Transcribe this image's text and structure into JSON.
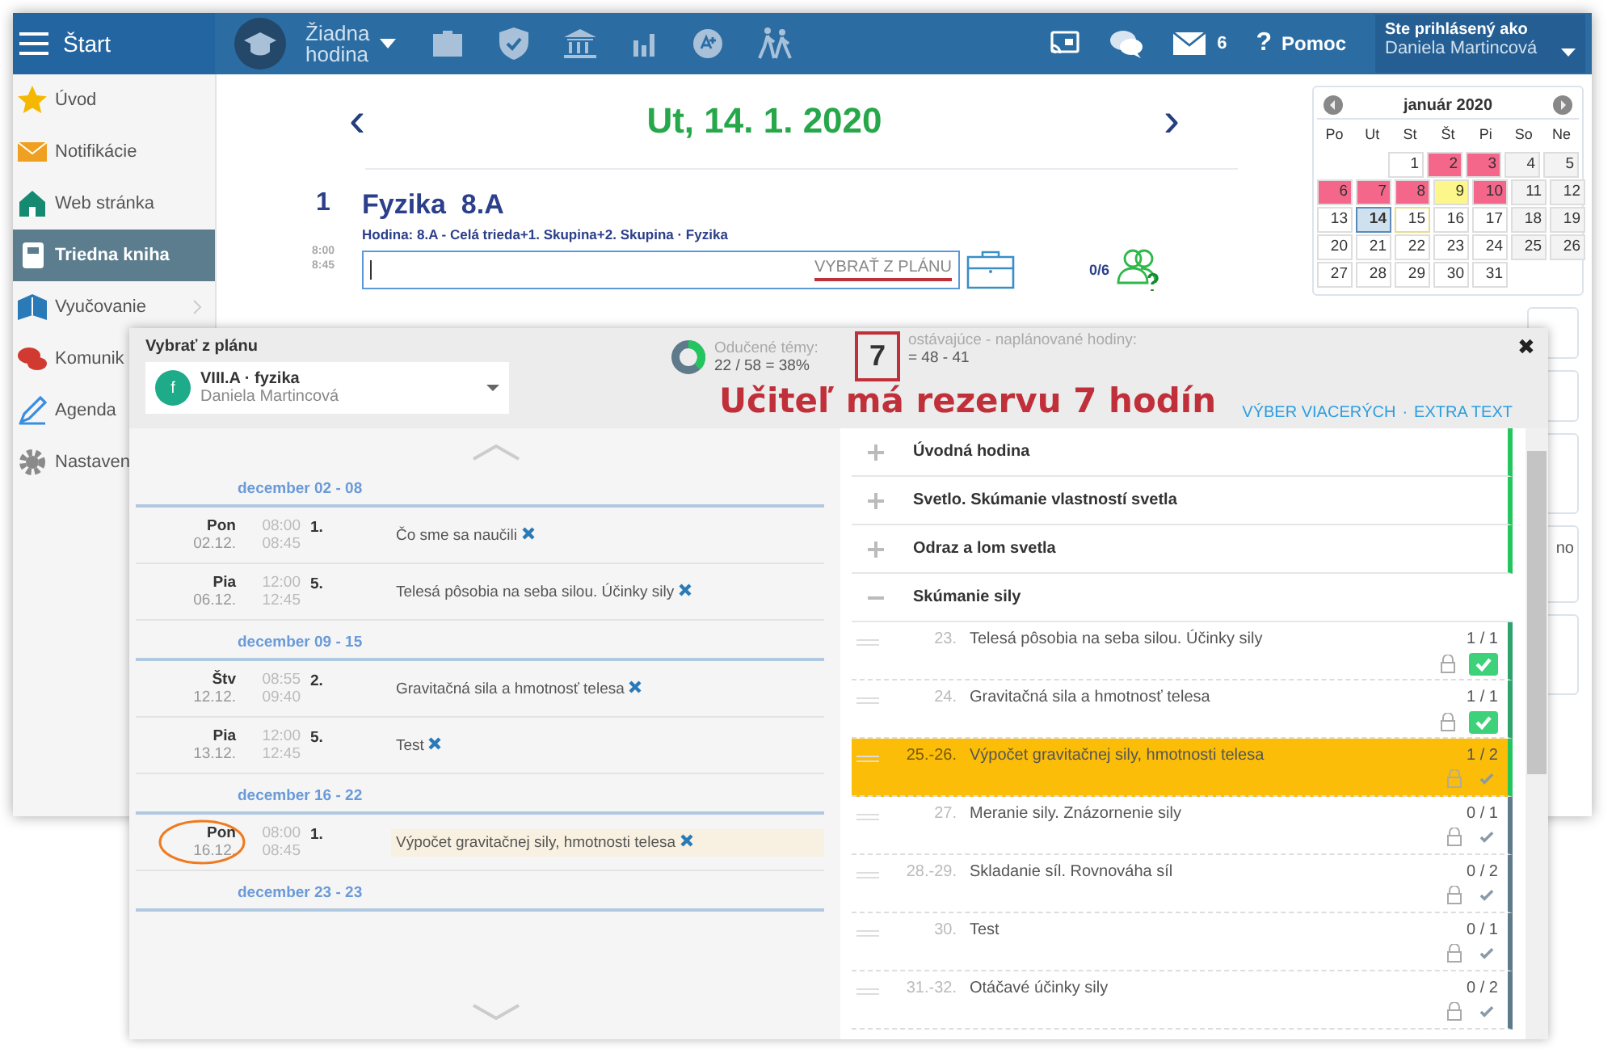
{
  "topbar": {
    "menu_label": "Štart",
    "lesson_select": [
      "Žiadna",
      "hodina"
    ],
    "messages_count": "6",
    "help_mark": "?",
    "help": "Pomoc",
    "user_caption": "Ste prihlásený ako",
    "user_name": "Daniela Martincová"
  },
  "sidebar": {
    "items": [
      {
        "kind": "star",
        "label": "Úvod",
        "selected": false,
        "expandable": false
      },
      {
        "kind": "mail",
        "label": "Notifikácie",
        "selected": false,
        "expandable": false
      },
      {
        "kind": "home",
        "label": "Web stránka",
        "selected": false,
        "expandable": false
      },
      {
        "kind": "book",
        "label": "Triedna kniha",
        "selected": true,
        "expandable": false
      },
      {
        "kind": "open-book",
        "label": "Vyučovanie",
        "selected": false,
        "expandable": true
      },
      {
        "kind": "chat",
        "label": "Komunik",
        "selected": false,
        "expandable": false
      },
      {
        "kind": "pen",
        "label": "Agenda",
        "selected": false,
        "expandable": false
      },
      {
        "kind": "gear",
        "label": "Nastaven",
        "selected": false,
        "expandable": false
      }
    ]
  },
  "day_view": {
    "prev": "‹",
    "date": "Ut, 14. 1. 2020",
    "next": "›",
    "lesson": {
      "number": "1",
      "subject": "Fyzika",
      "class": "8.A",
      "detail": "Hodina:  8.A - Celá trieda+1. Skupina+2. Skupina · Fyzika",
      "start": "8:00",
      "end": "8:45",
      "plan_link": "VYBRAŤ Z PLÁNU",
      "attendance": "0/6"
    }
  },
  "calendar": {
    "title": "január 2020",
    "weekdays": [
      "Po",
      "Ut",
      "St",
      "Št",
      "Pi",
      "So",
      "Ne"
    ],
    "weeks": [
      {
        "starts_midweek": true,
        "days": [
          {
            "day": "1",
            "kind": "weekday",
            "selected": false
          },
          {
            "day": "2",
            "kind": "weekday",
            "color": "#f4668a",
            "selected": false
          },
          {
            "day": "3",
            "kind": "weekday",
            "color": "#f4668a",
            "selected": false
          },
          {
            "day": "4",
            "kind": "weekend",
            "selected": false
          },
          {
            "day": "5",
            "kind": "weekend",
            "selected": false
          }
        ]
      },
      {
        "starts_midweek": false,
        "days": [
          {
            "day": "6",
            "kind": "weekday",
            "color": "#f4668a",
            "selected": false
          },
          {
            "day": "7",
            "kind": "weekday",
            "color": "#f4668a",
            "selected": false
          },
          {
            "day": "8",
            "kind": "weekday",
            "color": "#f4668a",
            "selected": false
          },
          {
            "day": "9",
            "kind": "weekday",
            "color": "#fdf68a",
            "selected": false
          },
          {
            "day": "10",
            "kind": "weekday",
            "color": "#f4668a",
            "selected": false
          },
          {
            "day": "11",
            "kind": "weekend",
            "selected": false
          },
          {
            "day": "12",
            "kind": "weekend",
            "selected": false
          }
        ]
      },
      {
        "starts_midweek": false,
        "days": [
          {
            "day": "13",
            "kind": "weekday",
            "selected": false
          },
          {
            "day": "14",
            "kind": "weekday",
            "selected": true
          },
          {
            "day": "15",
            "kind": "outlined",
            "selected": false
          },
          {
            "day": "16",
            "kind": "weekday",
            "selected": false
          },
          {
            "day": "17",
            "kind": "weekday",
            "selected": false
          },
          {
            "day": "18",
            "kind": "weekend",
            "selected": false
          },
          {
            "day": "19",
            "kind": "weekend",
            "selected": false
          }
        ]
      },
      {
        "starts_midweek": false,
        "days": [
          {
            "day": "20",
            "kind": "weekday",
            "selected": false
          },
          {
            "day": "21",
            "kind": "weekday",
            "selected": false
          },
          {
            "day": "22",
            "kind": "weekday",
            "selected": false
          },
          {
            "day": "23",
            "kind": "weekday",
            "selected": false
          },
          {
            "day": "24",
            "kind": "weekday",
            "selected": false
          },
          {
            "day": "25",
            "kind": "weekend",
            "selected": false
          },
          {
            "day": "26",
            "kind": "weekend",
            "selected": false
          }
        ]
      },
      {
        "starts_midweek": false,
        "days": [
          {
            "day": "27",
            "kind": "weekday",
            "selected": false
          },
          {
            "day": "28",
            "kind": "weekday",
            "selected": false
          },
          {
            "day": "29",
            "kind": "weekday",
            "selected": false
          },
          {
            "day": "30",
            "kind": "weekday",
            "selected": false
          },
          {
            "day": "31",
            "kind": "weekday",
            "selected": false
          }
        ]
      }
    ]
  },
  "side_card_text": "no",
  "plan_dialog": {
    "title": "Vybrať z plánu",
    "plan": {
      "avatar": "f",
      "name": "VIII.A · fyzika",
      "teacher": "Daniela Martincová"
    },
    "progress": {
      "label": "Odučené témy:",
      "value": "22 / 58 = 38%",
      "level": 0.38
    },
    "remaining": {
      "count": "7",
      "label": "ostávajúce - naplánované hodiny:",
      "value": "= 48 - 41"
    },
    "links": [
      "VÝBER VIACERÝCH",
      "EXTRA TEXT"
    ],
    "link_separator": "·",
    "close": "✖",
    "weeks": [
      {
        "label": "december 02 - 08",
        "rows": [
          {
            "day": "Pon",
            "date": "02.12.",
            "start": "08:00",
            "end": "08:45",
            "period": "1.",
            "topic": "Čo sme sa naučili",
            "highlighted": false,
            "circled": false
          },
          {
            "day": "Pia",
            "date": "06.12.",
            "start": "12:00",
            "end": "12:45",
            "period": "5.",
            "topic": "Telesá pôsobia na seba silou. Účinky sily",
            "highlighted": false,
            "circled": false
          }
        ]
      },
      {
        "label": "december 09 - 15",
        "rows": [
          {
            "day": "Štv",
            "date": "12.12.",
            "start": "08:55",
            "end": "09:40",
            "period": "2.",
            "topic": "Gravitačná sila a hmotnosť telesa",
            "highlighted": false,
            "circled": false
          },
          {
            "day": "Pia",
            "date": "13.12.",
            "start": "12:00",
            "end": "12:45",
            "period": "5.",
            "topic": "Test",
            "highlighted": false,
            "circled": false
          }
        ]
      },
      {
        "label": "december 16 - 22",
        "rows": [
          {
            "day": "Pon",
            "date": "16.12.",
            "start": "08:00",
            "end": "08:45",
            "period": "1.",
            "topic": "Výpočet gravitačnej sily, hmotnosti telesa",
            "highlighted": true,
            "circled": true
          }
        ]
      },
      {
        "label": "december 23 - 23"
      }
    ],
    "sections": [
      {
        "title": "Úvodná hodina",
        "expanded": false,
        "color": "#22c55e"
      },
      {
        "title": "Svetlo. Skúmanie vlastností svetla",
        "expanded": false,
        "color": "#22c55e"
      },
      {
        "title": "Odraz a lom svetla",
        "expanded": false,
        "color": "#22c55e"
      },
      {
        "title": "Skúmanie sily",
        "expanded": true,
        "items": [
          {
            "number": "23.",
            "title": "Telesá pôsobia na seba silou. Účinky sily",
            "count": "1 / 1",
            "done": true,
            "selected": false,
            "color": "#2ea36b"
          },
          {
            "number": "24.",
            "title": "Gravitačná sila a hmotnosť telesa",
            "count": "1 / 1",
            "done": true,
            "selected": false,
            "color": "#2ea36b"
          },
          {
            "number": "25.-26.",
            "title": "Výpočet gravitačnej sily, hmotnosti telesa",
            "count": "1 / 2",
            "done": false,
            "selected": true,
            "color": "#22c55e"
          },
          {
            "number": "27.",
            "title": "Meranie sily. Znázornenie sily",
            "count": "0 / 1",
            "done": false,
            "selected": false,
            "color": "#5f7a8a"
          },
          {
            "number": "28.-29.",
            "title": "Skladanie síl. Rovnováha síl",
            "count": "0 / 2",
            "done": false,
            "selected": false,
            "color": "#5f7a8a"
          },
          {
            "number": "30.",
            "title": "Test",
            "count": "0 / 1",
            "done": false,
            "selected": false,
            "color": "#5f7a8a"
          },
          {
            "number": "31.-32.",
            "title": "Otáčavé účinky sily",
            "count": "0 / 2",
            "done": false,
            "selected": false,
            "color": "#5f7a8a"
          }
        ]
      }
    ]
  },
  "annotation": {
    "note": "Učiteľ má rezervu 7 hodín"
  }
}
